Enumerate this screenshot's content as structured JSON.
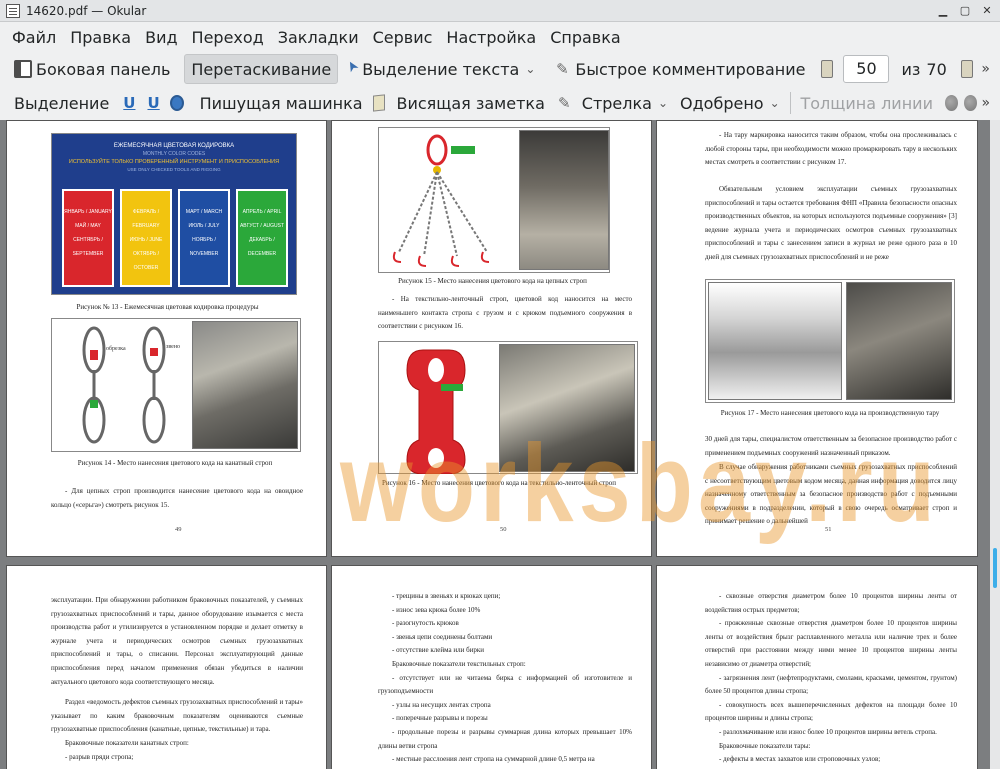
{
  "window": {
    "title": "14620.pdf — Okular"
  },
  "menu": [
    "Файл",
    "Правка",
    "Вид",
    "Переход",
    "Закладки",
    "Сервис",
    "Настройка",
    "Справка"
  ],
  "toolbar1": {
    "sidebar": "Боковая панель",
    "drag": "Перетаскивание",
    "text_select": "Выделение текста",
    "quick_comment": "Быстрое комментирование",
    "page_current": "50",
    "page_of": "из",
    "page_total": "70"
  },
  "toolbar2": {
    "selection": "Выделение",
    "typewriter": "Пишущая машинка",
    "note": "Висящая заметка",
    "arrow": "Стрелка",
    "approved": "Одобрено",
    "line_width": "Толщина линии"
  },
  "watermark": "worksbay.ru",
  "pages": {
    "p49": {
      "poster_title": "ЕЖЕМЕСЯЧНАЯ ЦВЕТОВАЯ КОДИРОВКА",
      "poster_subtitle": "MONTHLY COLOR CODES",
      "poster_line": "ИСПОЛЬЗУЙТЕ ТОЛЬКО ПРОВЕРЕННЫЙ ИНСТРУМЕНТ И ПРИСПОСОБЛЕНИЯ",
      "poster_line2": "USE ONLY CHECKED TOOLS AND RIGGING",
      "blocks": [
        {
          "color": "#d9262c",
          "l1": "ЯНВАРЬ / JANUARY",
          "l2": "МАЙ / MAY",
          "l3": "СЕНТЯБРЬ / SEPTEMBER"
        },
        {
          "color": "#f2c40f",
          "l1": "ФЕВРАЛЬ / FEBRUARY",
          "l2": "ИЮНЬ / JUNE",
          "l3": "ОКТЯБРЬ / OCTOBER"
        },
        {
          "color": "#1f4ea3",
          "l1": "МАРТ / MARCH",
          "l2": "ИЮЛЬ / JULY",
          "l3": "НОЯБРЬ / NOVEMBER"
        },
        {
          "color": "#2ba83a",
          "l1": "АПРЕЛЬ / APRIL",
          "l2": "АВГУСТ / AUGUST",
          "l3": "ДЕКАБРЬ / DECEMBER"
        }
      ],
      "cap13": "Рисунок № 13 - Ежемесячная цветовая кодировка процедуры",
      "label_a": "обрезка",
      "label_b": "звено",
      "cap14": "Рисунок 14 - Место нанесения цветового кода на канатный строп",
      "text1": "- Для цепных строп производится нанесение цветового кода на овоидное кольцо («серьга») смотреть рисунок 15.",
      "num": "49"
    },
    "p50": {
      "cap15": "Рисунок 15 - Место нанесения цветового кода на цепных строп",
      "text1": "- На текстильно-ленточный строп, цветовой код наносится на место наименьшего контакта стропа с грузом и с крюком подъемного сооружения в соответствии с рисунком 16.",
      "cap16": "Рисунок 16 - Место нанесения цветового кода на текстильно-ленточный строп",
      "num": "50"
    },
    "p51": {
      "text1": "- На тару маркировка наносится таким образом, чтобы она прослеживалась с любой стороны тары, при необходимости можно промаркировать тару в нескольких местах смотреть в соответствии с рисунком 17.",
      "text2": "Обязательным условием эксплуатации съемных грузозахватных приспособлений и тары остается требования ФНП «Правила безопасности опасных производственных объектов, на которых используются подъемные сооружения» [3] ведение журнала учета и периодических осмотров съемных грузозахватных приспособлений и тары с занесением записи в журнал не реже одного раза в 10 дней для съемных грузозахватных приспособлений и не реже",
      "cap17": "Рисунок 17 - Место нанесения цветового кода на производственную тару",
      "text3": "30 дней для тары, специалистом ответственным за безопасное производство работ с применением подъемных сооружений назначенный приказом.",
      "text4": "В случае обнаружения работниками съемных грузозахватных приспособлений с несоответствующим цветовым кодом месяца, данная информация доводится лицу назначенному ответственным за безопасное производство работ с подъемными сооружениями в подразделении, который в свою очередь осматривает строп и принимает решение о дальнейшей",
      "num": "51"
    },
    "p52": {
      "text1": "эксплуатации. При обнаружении работником браковочных показателей, у съемных грузозахватных приспособлений и тары, данное оборудование изымается с места производства работ и утилизируется в установленном порядке и делает отметку в журнале учета и периодических осмотров съемных грузозахватных приспособлений и тары, о списании. Персонал эксплуатирующий данные приспособления перед началом применения обязан убедиться в наличии актуального цветового кода соответствующего месяца.",
      "text2": "Раздел «ведомость дефектов съемных грузозахватных приспособлений и тары» указывает по каким браковочным показателям оцениваются съемные грузозахватные приспособления (канатные, цепные, текстильные) и тара.",
      "text3": "Браковочные показатели канатных строп:",
      "text4": "- разрыв пряди стропа;"
    },
    "p53": {
      "lines": [
        "- трещины в звеньях и крюках цепи;",
        "- износ зева крюка более 10%",
        "- разогнутость крюков",
        "- звенья цепи соединены болтами",
        "- отсутствие клейма или бирки",
        "Браковочные показатели текстильных строп:",
        "- отсутствует или не читаема бирка с информацией об изготовителе и грузоподъемности",
        "- узлы на несущих лентах стропа",
        "- поперечные разрывы и порезы",
        "- продольные порезы и разрывы суммарная длина которых превышает 10% длины ветви стропа",
        "- местные расслоения лент стропа на суммарной длине 0,5 метра на"
      ]
    },
    "p54": {
      "lines": [
        "- сквозные отверстия диаметром более 10 процентов ширины ленты от воздействия острых предметов;",
        "- прожженные сквозные отверстия диаметром более 10 процентов ширины ленты от воздействия брызг расплавленного металла или наличие трех и более отверстий при расстоянии между ними менее 10 процентов ширины ленты независимо от диаметра отверстий;",
        "- загрязнения лент (нефтепродуктами, смолами, красками, цементом, грунтом) более 50 процентов длины стропа;",
        "- совокупность всех вышеперечисленных дефектов на площади более 10 процентов ширины и длины стропа;",
        "- разлохмачивание или износ более 10 процентов ширины ветель стропа.",
        "Браковочные показатели тары:",
        "- дефекты в местах захватов или строповочных узлов;"
      ]
    }
  }
}
